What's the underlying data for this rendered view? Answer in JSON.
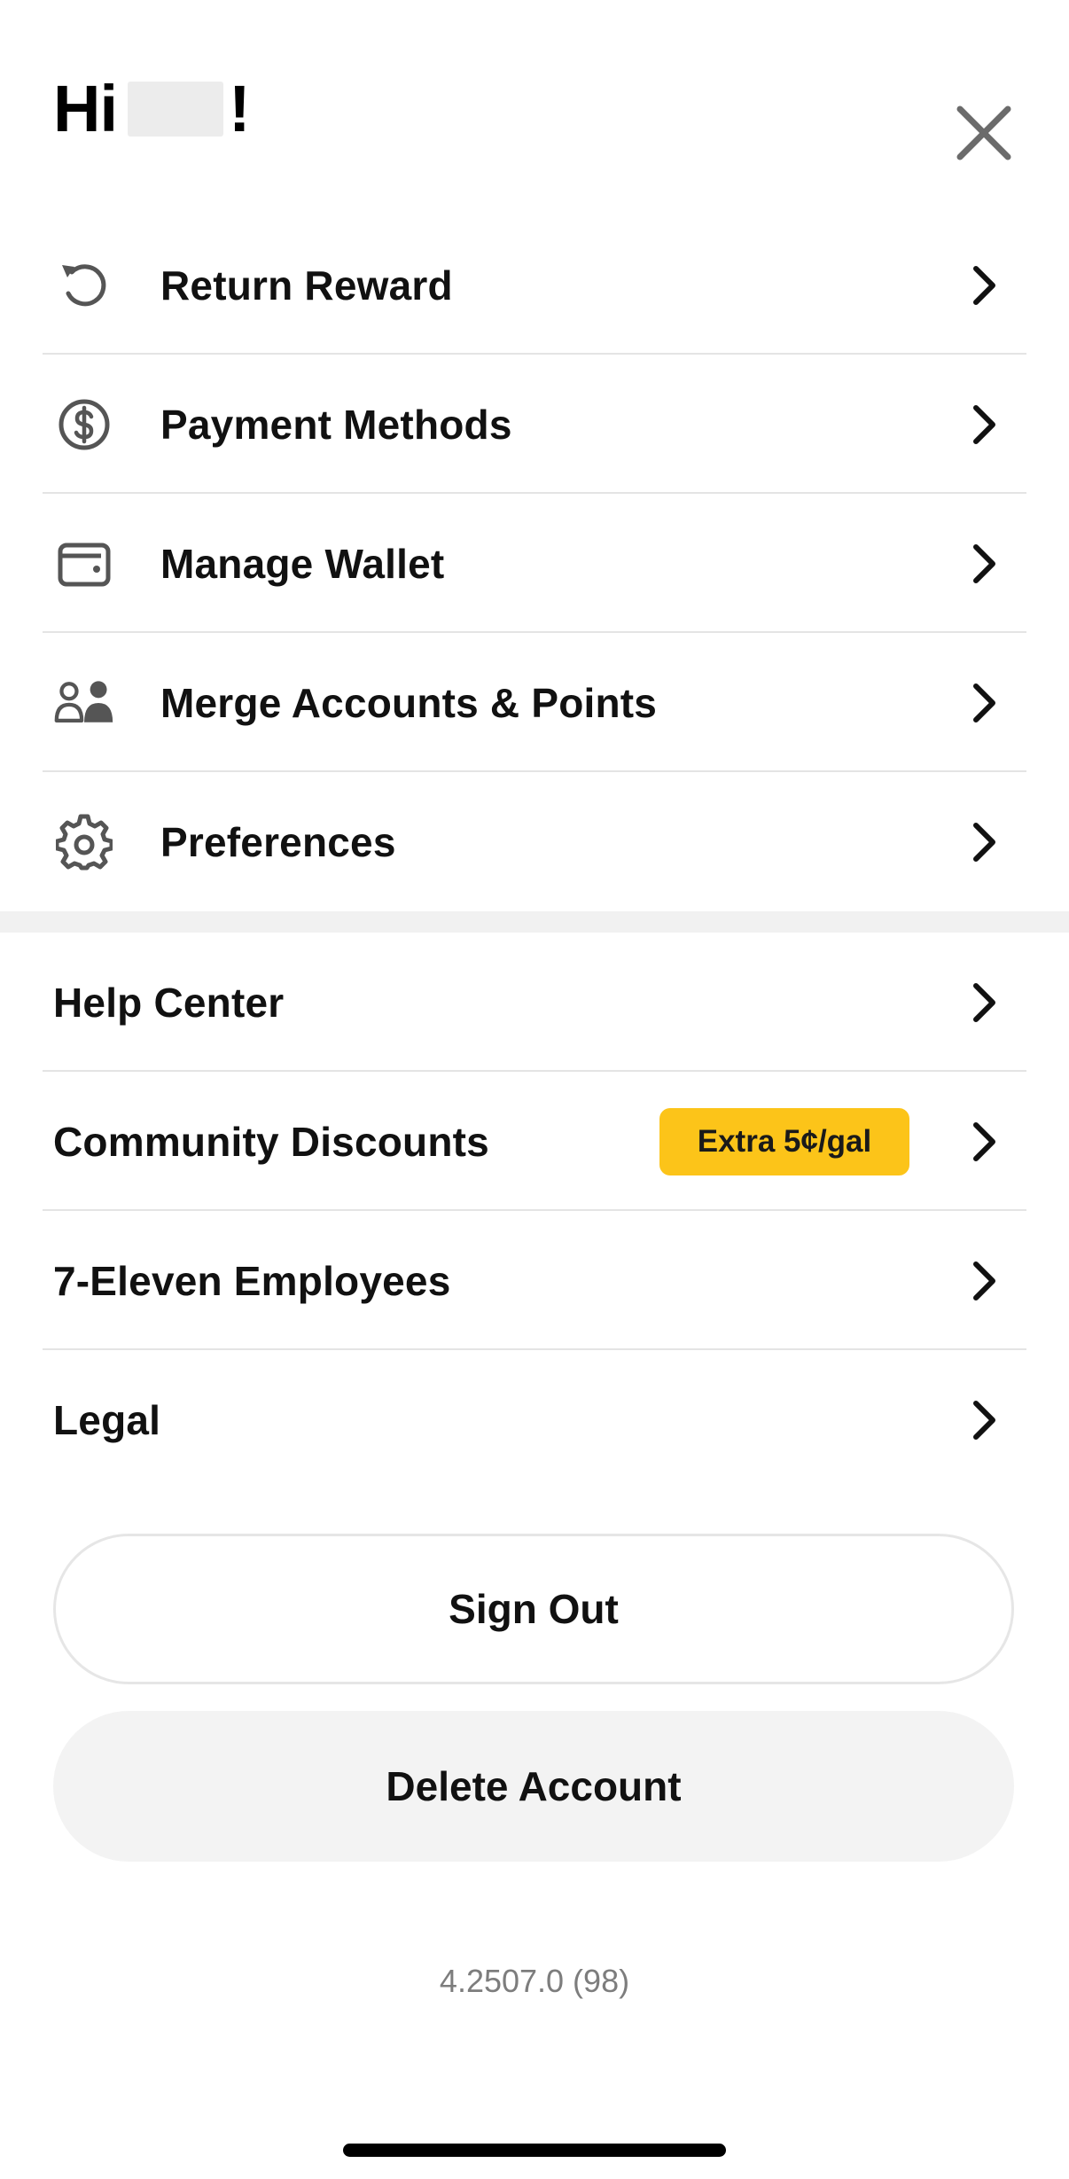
{
  "header": {
    "greeting_prefix": "Hi",
    "greeting_suffix": "!"
  },
  "menu_primary": [
    {
      "label": "Return Reward",
      "icon": "return-reward-icon"
    },
    {
      "label": "Payment Methods",
      "icon": "dollar-circle-icon"
    },
    {
      "label": "Manage Wallet",
      "icon": "wallet-icon"
    },
    {
      "label": "Merge Accounts & Points",
      "icon": "merge-users-icon"
    },
    {
      "label": "Preferences",
      "icon": "gear-icon"
    }
  ],
  "menu_secondary": [
    {
      "label": "Help Center"
    },
    {
      "label": "Community Discounts",
      "badge": "Extra 5¢/gal"
    },
    {
      "label": "7-Eleven Employees"
    },
    {
      "label": "Legal"
    }
  ],
  "buttons": {
    "sign_out": "Sign Out",
    "delete_account": "Delete Account"
  },
  "version": "4.2507.0 (98)",
  "colors": {
    "badge": "#fcc419",
    "section_gap": "#f1f1f1",
    "icon_gray": "#555555"
  }
}
